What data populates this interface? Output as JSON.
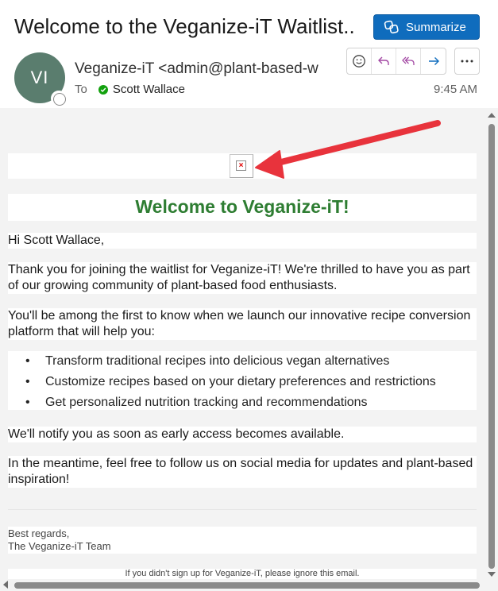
{
  "header": {
    "subject": "Welcome to the Veganize-iT Waitlist...",
    "summarize_label": "Summarize",
    "avatar_initials": "VI",
    "sender": "Veganize-iT <admin@plant-based-w",
    "to_label": "To",
    "recipient": "Scott Wallace",
    "time": "9:45 AM"
  },
  "actions": {
    "icons": [
      "emoji-icon",
      "reply-icon",
      "reply-all-icon",
      "forward-icon",
      "more-icon"
    ]
  },
  "email": {
    "title": "Welcome to Veganize-iT!",
    "greeting": "Hi Scott Wallace,",
    "para1": "Thank you for joining the waitlist for Veganize-iT! We're thrilled to have you as part of our growing community of plant-based food enthusiasts.",
    "para2": "You'll be among the first to know when we launch our innovative recipe conversion platform that will help you:",
    "bullets": [
      "Transform traditional recipes into delicious vegan alternatives",
      "Customize recipes based on your dietary preferences and restrictions",
      "Get personalized nutrition tracking and recommendations"
    ],
    "para3": "We'll notify you as soon as early access becomes available.",
    "para4": "In the meantime, feel free to follow us on social media for updates and plant-based inspiration!",
    "signoff_1": "Best regards,",
    "signoff_2": "The Veganize-iT Team",
    "footer": "If you didn't sign up for Veganize-iT, please ignore this email."
  },
  "colors": {
    "accent": "#0f6cbd",
    "title_green": "#2e7d32",
    "annotation_red": "#e8333c",
    "avatar_bg": "#5a7d6e"
  }
}
